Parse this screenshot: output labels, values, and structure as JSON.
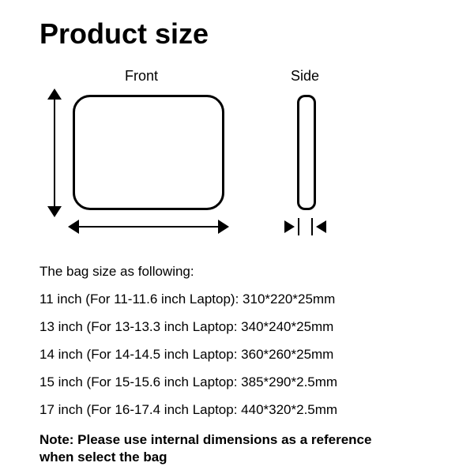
{
  "title": "Product size",
  "diagram": {
    "front_label": "Front",
    "side_label": "Side"
  },
  "intro": "The bag size as following:",
  "rows": [
    "11 inch (For 11-11.6 inch Laptop): 310*220*25mm",
    "13 inch (For 13-13.3 inch Laptop: 340*240*25mm",
    "14 inch (For 14-14.5 inch Laptop: 360*260*25mm",
    "15 inch (For 15-15.6 inch Laptop: 385*290*2.5mm",
    "17 inch (For 16-17.4 inch Laptop: 440*320*2.5mm"
  ],
  "note": "Note: Please use internal dimensions as a reference when select the bag"
}
